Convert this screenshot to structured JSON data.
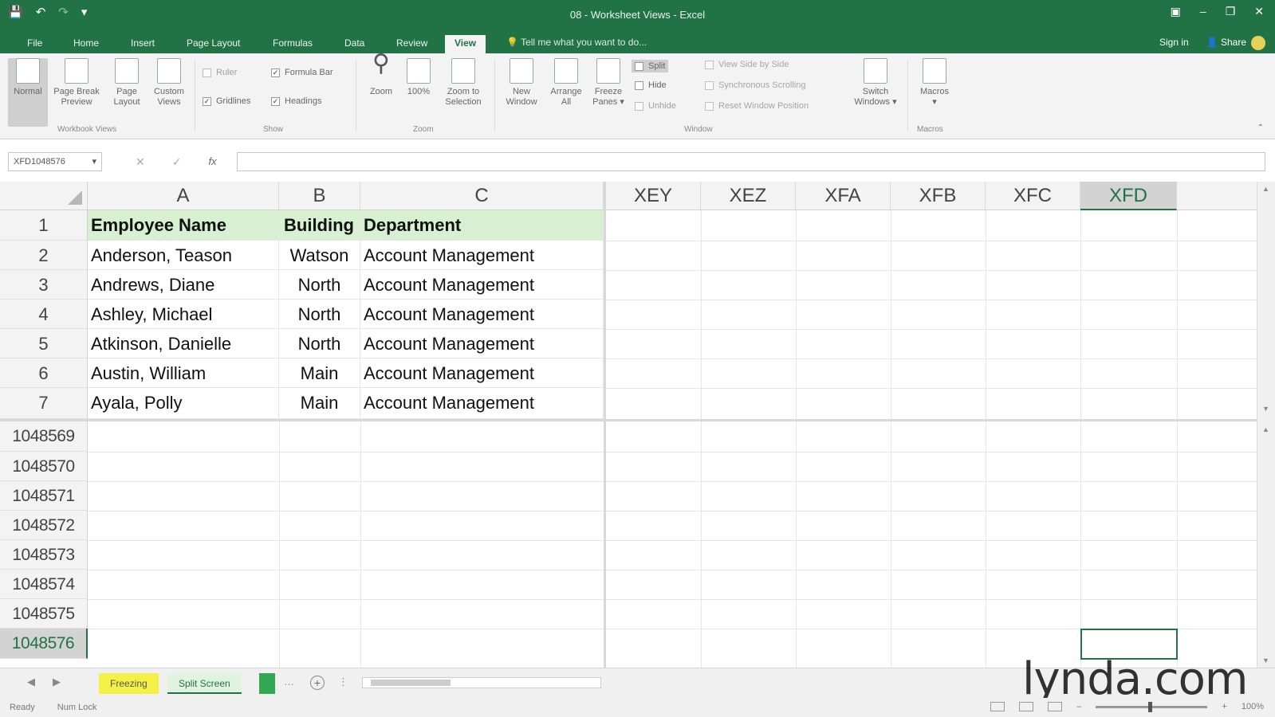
{
  "app": {
    "title": "08 - Worksheet Views - Excel"
  },
  "tabs": [
    "File",
    "Home",
    "Insert",
    "Page Layout",
    "Formulas",
    "Data",
    "Review",
    "View"
  ],
  "tell_me": "Tell me what you want to do...",
  "account": {
    "sign_in": "Sign in",
    "share": "Share"
  },
  "ribbon": {
    "workbook_views": {
      "label": "Workbook Views",
      "buttons": [
        "Normal",
        "Page Break Preview",
        "Page Layout",
        "Custom Views"
      ]
    },
    "show": {
      "label": "Show",
      "ruler": "Ruler",
      "formula_bar": "Formula Bar",
      "gridlines": "Gridlines",
      "headings": "Headings"
    },
    "zoom": {
      "label": "Zoom",
      "buttons": [
        "Zoom",
        "100%",
        "Zoom to Selection"
      ]
    },
    "window": {
      "label": "Window",
      "new_window": "New Window",
      "arrange_all": "Arrange All",
      "freeze_panes": "Freeze Panes",
      "split": "Split",
      "hide": "Hide",
      "unhide": "Unhide",
      "view_side_by_side": "View Side by Side",
      "sync_scrolling": "Synchronous Scrolling",
      "reset_position": "Reset Window Position",
      "switch_windows": "Switch Windows"
    },
    "macros": {
      "label": "Macros",
      "button": "Macros"
    }
  },
  "formula_bar": {
    "name_box": "XFD1048576",
    "fx": "fx",
    "value": ""
  },
  "columns_left": [
    "A",
    "B",
    "C"
  ],
  "columns_right": [
    "XEY",
    "XEZ",
    "XFA",
    "XFB",
    "XFC",
    "XFD"
  ],
  "rows_top": [
    {
      "num": "1",
      "a": "Employee Name",
      "b": "Building",
      "c": "Department"
    },
    {
      "num": "2",
      "a": "Anderson, Teason",
      "b": "Watson",
      "c": "Account Management"
    },
    {
      "num": "3",
      "a": "Andrews, Diane",
      "b": "North",
      "c": "Account Management"
    },
    {
      "num": "4",
      "a": "Ashley, Michael",
      "b": "North",
      "c": "Account Management"
    },
    {
      "num": "5",
      "a": "Atkinson, Danielle",
      "b": "North",
      "c": "Account Management"
    },
    {
      "num": "6",
      "a": "Austin, William",
      "b": "Main",
      "c": "Account Management"
    },
    {
      "num": "7",
      "a": "Ayala, Polly",
      "b": "Main",
      "c": "Account Management"
    }
  ],
  "rows_bottom": [
    "1048569",
    "1048570",
    "1048571",
    "1048572",
    "1048573",
    "1048574",
    "1048575",
    "1048576"
  ],
  "sheets": [
    "Freezing",
    "Split Screen"
  ],
  "status": {
    "mode": "Ready",
    "num_lock": "Num Lock",
    "zoom": "100%"
  },
  "watermark": "lynda.com",
  "colors": {
    "accent": "#217346",
    "header_fill": "#d7f0d2",
    "tab_yellow": "#f5f046"
  }
}
